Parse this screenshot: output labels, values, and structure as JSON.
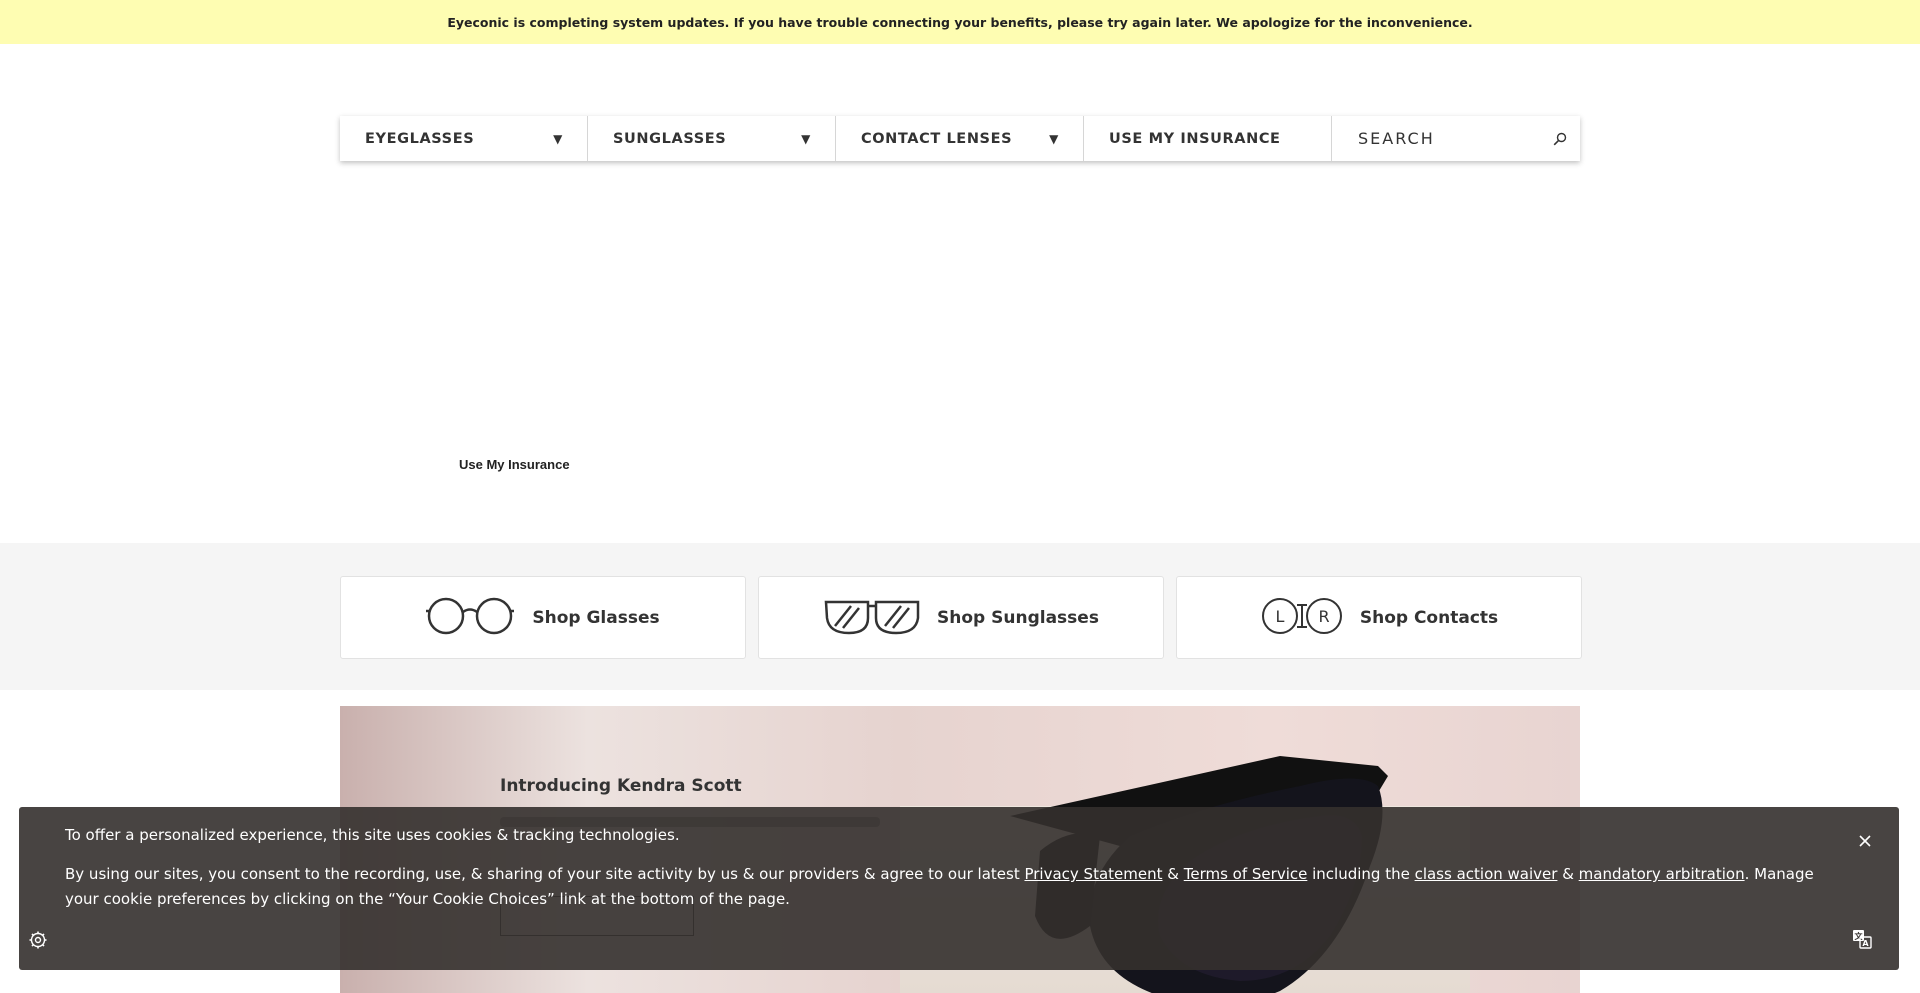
{
  "banner": {
    "text": "Eyeconic is completing system updates. If you have trouble connecting your benefits, please try again later. We apologize for the inconvenience."
  },
  "nav": {
    "items": [
      {
        "label": "EYEGLASSES",
        "has_dropdown": true
      },
      {
        "label": "SUNGLASSES",
        "has_dropdown": true
      },
      {
        "label": "CONTACT LENSES",
        "has_dropdown": true
      },
      {
        "label": "USE MY INSURANCE",
        "has_dropdown": false
      }
    ],
    "caret_icon": "caret-down-icon",
    "search": {
      "placeholder": "SEARCH",
      "value": "",
      "icon": "search-icon"
    }
  },
  "insurance_link": "Use My Insurance",
  "shop": {
    "cards": [
      {
        "label": "Shop Glasses",
        "icon": "eyeglasses-icon"
      },
      {
        "label": "Shop Sunglasses",
        "icon": "sunglasses-icon"
      },
      {
        "label": "Shop Contacts",
        "icon": "contact-lenses-icon"
      }
    ]
  },
  "hero": {
    "title": "Introducing Kendra Scott"
  },
  "cookie": {
    "line1": "To offer a personalized experience, this site uses cookies & tracking technologies.",
    "line2_part1": "By using our sites, you consent to the recording, use, & sharing of your site activity by us & our providers & agree to our latest ",
    "privacy_link": "Privacy Statement",
    "amp1": " & ",
    "terms_link": "Terms of Service",
    "line2_part2": " including the ",
    "waiver_link": "class action waiver",
    "amp2": " & ",
    "arbitration_link": "mandatory arbitration",
    "line2_part3": ". Manage your cookie preferences by clicking on the “Your Cookie Choices” link at the bottom of the page."
  },
  "colors": {
    "banner_bg": "#fefdb2",
    "shop_band_bg": "#f5f5f5",
    "cookie_bg": "#34302e",
    "text": "#333333"
  }
}
